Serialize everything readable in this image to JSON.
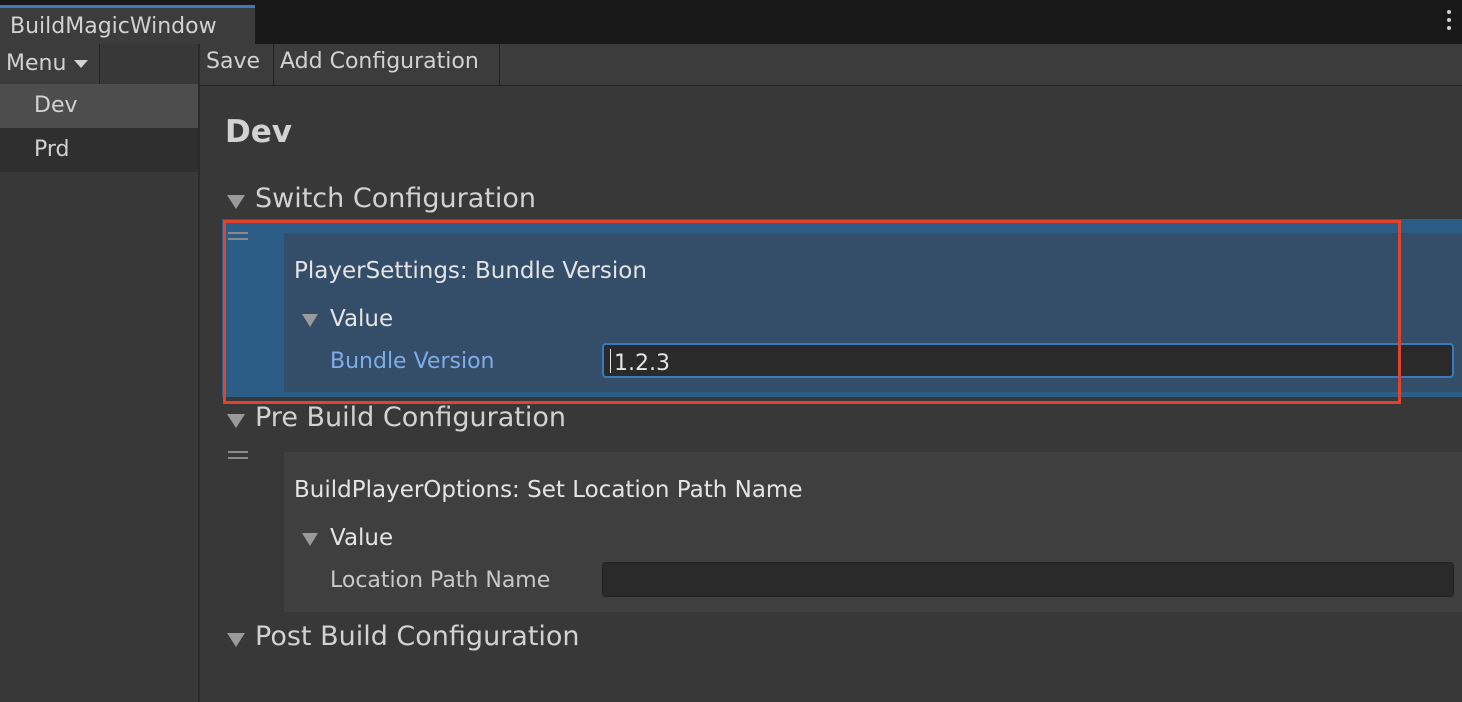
{
  "window": {
    "tab_title": "BuildMagicWindow"
  },
  "sidebar": {
    "menu_label": "Menu",
    "items": [
      {
        "label": "Dev",
        "selected": true
      },
      {
        "label": "Prd",
        "selected": false
      }
    ]
  },
  "toolbar": {
    "save_label": "Save",
    "add_configuration_label": "Add Configuration"
  },
  "main": {
    "title": "Dev",
    "sections": [
      {
        "label": "Switch Configuration",
        "expanded": true,
        "entries": [
          {
            "title": "PlayerSettings: Bundle Version",
            "value_label": "Value",
            "field_label": "Bundle Version",
            "field_value": "1.2.3",
            "selected": true
          }
        ]
      },
      {
        "label": "Pre Build Configuration",
        "expanded": true,
        "entries": [
          {
            "title": "BuildPlayerOptions: Set Location Path Name",
            "value_label": "Value",
            "field_label": "Location Path Name",
            "field_value": "",
            "selected": false
          }
        ]
      },
      {
        "label": "Post Build Configuration",
        "expanded": true,
        "entries": []
      }
    ]
  },
  "colors": {
    "accent": "#3a79bb",
    "selection": "#2c5d87",
    "highlight_box": "#e0442f",
    "focused_label": "#7fadea"
  }
}
